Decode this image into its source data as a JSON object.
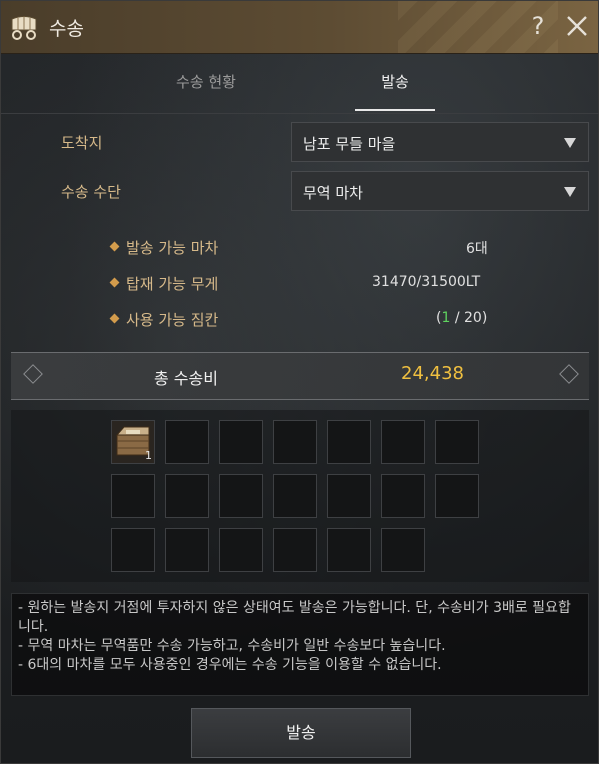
{
  "window": {
    "title": "수송"
  },
  "tabs": [
    {
      "label": "수송 현황",
      "active": false
    },
    {
      "label": "발송",
      "active": true
    }
  ],
  "destination": {
    "label": "도착지",
    "value": "남포 무들 마을"
  },
  "transport": {
    "label": "수송 수단",
    "value": "무역 마차"
  },
  "info": {
    "available_wagons": {
      "label": "발송 가능 마차",
      "value": "6대"
    },
    "load_weight": {
      "label": "탑재 가능 무게",
      "value": "31470/31500LT"
    },
    "slots": {
      "label": "사용 가능 짐칸",
      "used": "1",
      "total": " / 20)",
      "open": "("
    }
  },
  "total": {
    "label": "총 수송비",
    "value": "24,438"
  },
  "inventory": {
    "item": {
      "name": "trade-crate-icon",
      "count": "1"
    }
  },
  "notes": [
    "- 원하는 발송지 거점에 투자하지 않은 상태여도 발송은 가능합니다. 단, 수송비가 3배로 필요합니다.",
    "- 무역 마차는 무역품만 수송 가능하고, 수송비가 일반 수송보다 높습니다.",
    "- 6대의 마차를 모두 사용중인 경우에는 수송 기능을 이용할 수 없습니다."
  ],
  "send_button": {
    "label": "발송"
  },
  "colors": {
    "accent_gold": "#f0c040",
    "label_tan": "#d6b98a",
    "count_green": "#5fd35f"
  }
}
